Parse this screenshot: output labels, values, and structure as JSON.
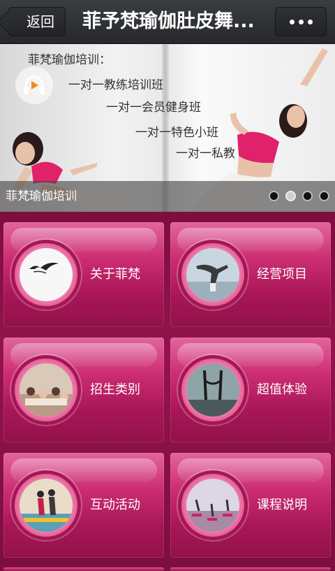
{
  "header": {
    "back_label": "返回",
    "title": "菲予梵瑜伽肚皮舞..."
  },
  "banner": {
    "heading": "菲梵瑜伽培训：",
    "lines": [
      "一对一教练培训班",
      "一对一会员健身班",
      "一对一特色小班",
      "一对一私教"
    ],
    "caption": "菲梵瑜伽培训",
    "slide_count": 4,
    "active_slide": 2
  },
  "menu": {
    "items": [
      {
        "label": "关于菲梵",
        "icon": "bird-sketch-thumbnail"
      },
      {
        "label": "经营项目",
        "icon": "yoga-pose-thumbnail"
      },
      {
        "label": "招生类别",
        "icon": "class-group-thumbnail"
      },
      {
        "label": "超值体验",
        "icon": "stretch-pose-thumbnail"
      },
      {
        "label": "互动活动",
        "icon": "partner-yoga-thumbnail"
      },
      {
        "label": "课程说明",
        "icon": "studio-class-thumbnail"
      }
    ]
  },
  "colors": {
    "accent": "#cc2d72",
    "card_dark": "#921149",
    "topbar": "#2b2d30"
  }
}
